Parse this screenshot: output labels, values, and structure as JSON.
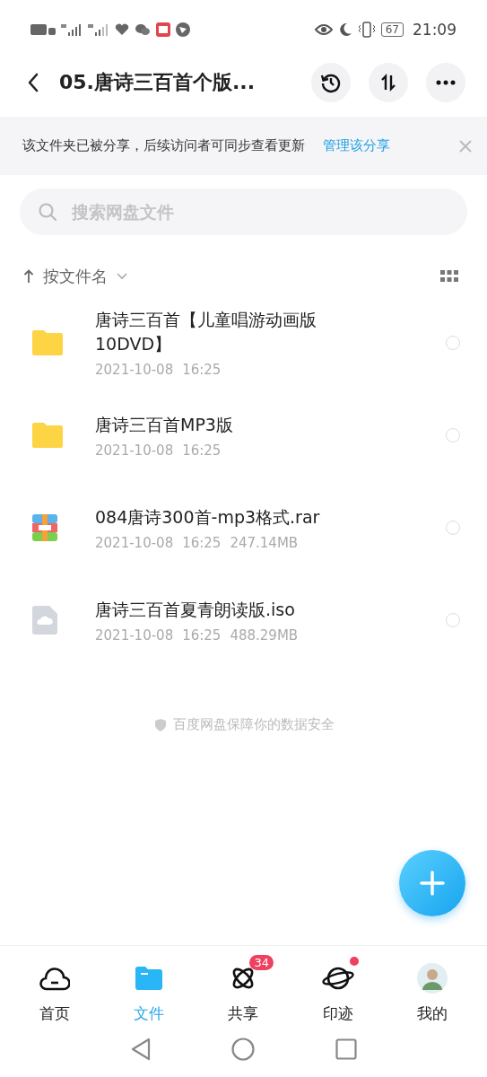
{
  "status_bar": {
    "battery": "67",
    "time": "21:09"
  },
  "header": {
    "title": "05.唐诗三百首个版..."
  },
  "share_banner": {
    "text": "该文件夹已被分享，后续访问者可同步查看更新",
    "link": "管理该分享"
  },
  "search": {
    "placeholder": "搜索网盘文件"
  },
  "sort": {
    "label": "按文件名"
  },
  "files": [
    {
      "kind": "folder",
      "name": "唐诗三百首【儿童唱游动画版10DVD】",
      "date": "2021-10-08",
      "time": "16:25",
      "selected": false
    },
    {
      "kind": "folder",
      "name": "唐诗三百首MP3版",
      "date": "2021-10-08",
      "time": "16:25",
      "selected": false
    },
    {
      "kind": "archive",
      "name": "084唐诗300首-mp3格式.rar",
      "date": "2021-10-08",
      "time": "16:25",
      "size": "247.14MB",
      "selected": false
    },
    {
      "kind": "disk",
      "name": "唐诗三百首夏青朗读版.iso",
      "date": "2021-10-08",
      "time": "16:25",
      "size": "488.29MB",
      "selected": false
    }
  ],
  "footer_note": "百度网盘保障你的数据安全",
  "tabs": [
    {
      "kind": "home",
      "label": "首页",
      "selected": false
    },
    {
      "kind": "files",
      "label": "文件",
      "selected": true
    },
    {
      "kind": "share",
      "label": "共享",
      "selected": false,
      "badge": "34"
    },
    {
      "kind": "planet",
      "label": "印迹",
      "selected": false,
      "dot": true
    },
    {
      "kind": "me",
      "label": "我的",
      "selected": false
    }
  ]
}
